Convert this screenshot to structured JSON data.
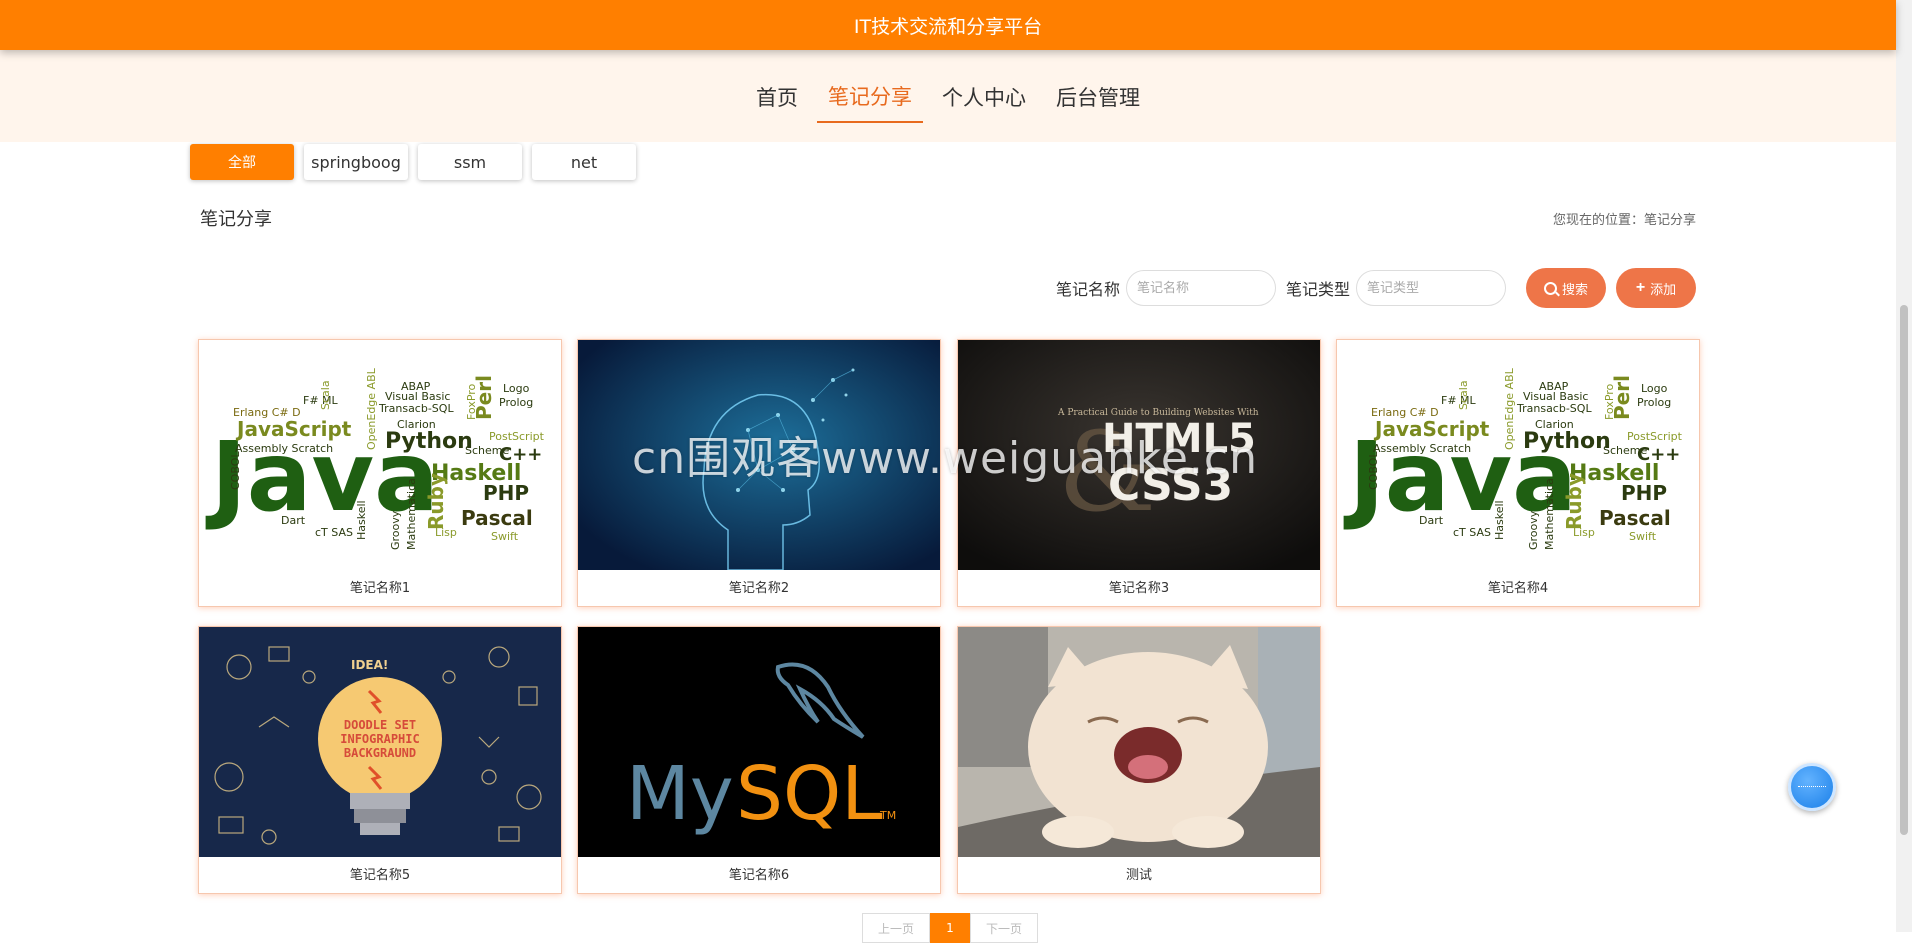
{
  "header": {
    "site_title": "IT技术交流和分享平台"
  },
  "nav": {
    "items": [
      {
        "label": "首页"
      },
      {
        "label": "笔记分享"
      },
      {
        "label": "个人中心"
      },
      {
        "label": "后台管理"
      }
    ],
    "active_index": 1
  },
  "categories": [
    {
      "label": "全部"
    },
    {
      "label": "springboog"
    },
    {
      "label": "ssm"
    },
    {
      "label": "net"
    }
  ],
  "section": {
    "title": "笔记分享",
    "breadcrumb_prefix": "您现在的位置：",
    "breadcrumb_current": "笔记分享"
  },
  "search": {
    "name_label": "笔记名称",
    "name_placeholder": "笔记名称",
    "type_label": "笔记类型",
    "type_placeholder": "笔记类型",
    "search_button": "搜索",
    "add_button": "添加"
  },
  "notes": [
    {
      "title": "笔记名称1",
      "image": "java-word-cloud"
    },
    {
      "title": "笔记名称2",
      "image": "digital-head"
    },
    {
      "title": "笔记名称3",
      "image": "html5-css3-book"
    },
    {
      "title": "笔记名称4",
      "image": "java-word-cloud"
    },
    {
      "title": "笔记名称5",
      "image": "doodle-lightbulb"
    },
    {
      "title": "笔记名称6",
      "image": "mysql-logo"
    },
    {
      "title": "测试",
      "image": "yawning-cat"
    }
  ],
  "pagination": {
    "prev": "上一页",
    "current": "1",
    "next": "下一页"
  },
  "watermark": "cn围观客www.weiguanke.cn",
  "colors": {
    "primary": "#ff7f00",
    "accent": "#ee7548",
    "nav_bg": "#fff5ec"
  }
}
